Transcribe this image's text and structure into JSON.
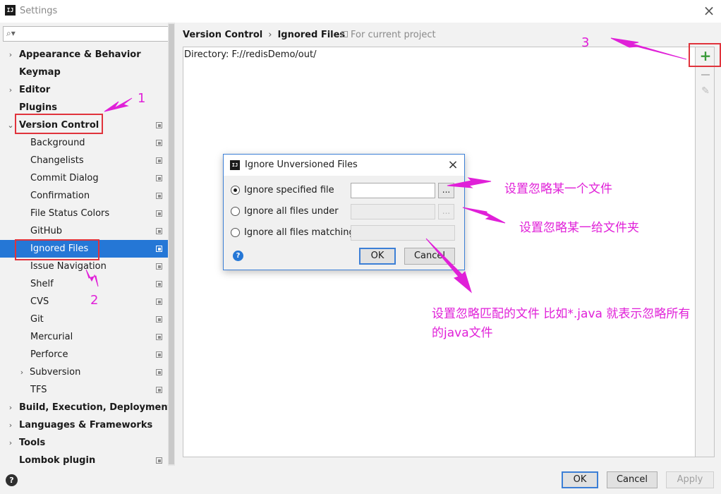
{
  "window": {
    "title": "Settings"
  },
  "search": {
    "placeholder": ""
  },
  "tree": [
    {
      "label": "Appearance & Behavior",
      "bold": true,
      "arrow": "›",
      "indent": 0,
      "proj": false
    },
    {
      "label": "Keymap",
      "bold": true,
      "arrow": "",
      "indent": 0,
      "proj": false
    },
    {
      "label": "Editor",
      "bold": true,
      "arrow": "›",
      "indent": 0,
      "proj": false
    },
    {
      "label": "Plugins",
      "bold": true,
      "arrow": "",
      "indent": 0,
      "proj": false
    },
    {
      "label": "Version Control",
      "bold": true,
      "arrow": "⌄",
      "indent": 0,
      "proj": true
    },
    {
      "label": "Background",
      "bold": false,
      "arrow": "",
      "indent": 1,
      "proj": true
    },
    {
      "label": "Changelists",
      "bold": false,
      "arrow": "",
      "indent": 1,
      "proj": true
    },
    {
      "label": "Commit Dialog",
      "bold": false,
      "arrow": "",
      "indent": 1,
      "proj": true
    },
    {
      "label": "Confirmation",
      "bold": false,
      "arrow": "",
      "indent": 1,
      "proj": true
    },
    {
      "label": "File Status Colors",
      "bold": false,
      "arrow": "",
      "indent": 1,
      "proj": true
    },
    {
      "label": "GitHub",
      "bold": false,
      "arrow": "",
      "indent": 1,
      "proj": true
    },
    {
      "label": "Ignored Files",
      "bold": false,
      "arrow": "",
      "indent": 1,
      "proj": true,
      "selected": true
    },
    {
      "label": "Issue Navigation",
      "bold": false,
      "arrow": "",
      "indent": 1,
      "proj": true
    },
    {
      "label": "Shelf",
      "bold": false,
      "arrow": "",
      "indent": 1,
      "proj": true
    },
    {
      "label": "CVS",
      "bold": false,
      "arrow": "",
      "indent": 1,
      "proj": true
    },
    {
      "label": "Git",
      "bold": false,
      "arrow": "",
      "indent": 1,
      "proj": true
    },
    {
      "label": "Mercurial",
      "bold": false,
      "arrow": "",
      "indent": 1,
      "proj": true
    },
    {
      "label": "Perforce",
      "bold": false,
      "arrow": "",
      "indent": 1,
      "proj": true
    },
    {
      "label": "Subversion",
      "bold": false,
      "arrow": "›",
      "indent": 1,
      "proj": true
    },
    {
      "label": "TFS",
      "bold": false,
      "arrow": "",
      "indent": 1,
      "proj": true
    },
    {
      "label": "Build, Execution, Deployment",
      "bold": true,
      "arrow": "›",
      "indent": 0,
      "proj": false
    },
    {
      "label": "Languages & Frameworks",
      "bold": true,
      "arrow": "›",
      "indent": 0,
      "proj": false
    },
    {
      "label": "Tools",
      "bold": true,
      "arrow": "›",
      "indent": 0,
      "proj": false
    },
    {
      "label": "Lombok plugin",
      "bold": true,
      "arrow": "",
      "indent": 0,
      "proj": true
    }
  ],
  "breadcrumb": {
    "parent": "Version Control",
    "separator": "›",
    "current": "Ignored Files"
  },
  "scope": "For current project",
  "ignored_list": [
    "Directory: F://redisDemo/out/"
  ],
  "toolbar": {
    "add": "+",
    "edit": "✎"
  },
  "footer": {
    "help": "?",
    "ok": "OK",
    "cancel": "Cancel",
    "apply": "Apply"
  },
  "dialog": {
    "title": "Ignore Unversioned Files",
    "options": [
      {
        "label": "Ignore specified file",
        "checked": true
      },
      {
        "label": "Ignore all files under",
        "checked": false
      },
      {
        "label": "Ignore all files matching",
        "checked": false
      }
    ],
    "browse": "...",
    "ok": "OK",
    "cancel": "Cancel",
    "help": "?"
  },
  "annotations": {
    "num1": "1",
    "num2": "2",
    "num3": "3",
    "note_file": "设置忽略某一个文件",
    "note_folder": "设置忽略某一给文件夹",
    "note_match_line1": "设置忽略匹配的文件 比如*.java 就表示忽略所有",
    "note_match_line2": "的java文件",
    "color": "#e020d8",
    "highlight_color": "#e0333c"
  },
  "colors": {
    "selection": "#2577d6",
    "dialog_border": "#3c7fd6",
    "add_icon": "#3a9a3a"
  }
}
